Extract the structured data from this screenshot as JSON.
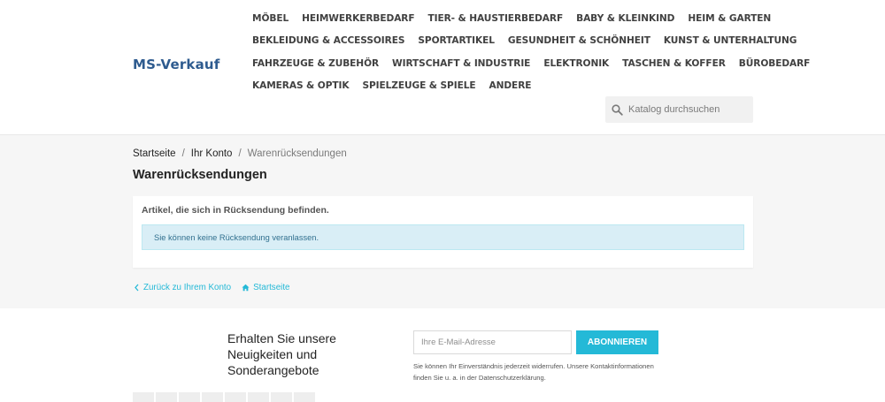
{
  "site": {
    "logo": "MS-Verkauf"
  },
  "nav": {
    "rows": [
      [
        "Möbel",
        "Heimwerkerbedarf",
        "Tier- & Haustierbedarf",
        "Baby & Kleinkind",
        "Heim & Garten"
      ],
      [
        "Bekleidung & Accessoires",
        "Sportartikel",
        "Gesundheit & Schönheit",
        "Kunst & Unterhaltung"
      ],
      [
        "Fahrzeuge & Zubehör",
        "Wirtschaft & Industrie",
        "Elektronik",
        "Taschen & Koffer",
        "Bürobedarf"
      ],
      [
        "Kameras & Optik",
        "Spielzeuge & Spiele",
        "Andere"
      ]
    ]
  },
  "search": {
    "placeholder": "Katalog durchsuchen",
    "icon": "search-icon"
  },
  "breadcrumb": {
    "home": "Startseite",
    "account": "Ihr Konto",
    "current": "Warenrücksendungen"
  },
  "page": {
    "title": "Warenrücksendungen",
    "lead": "Artikel, die sich in Rücksendung befinden.",
    "alert": "Sie können keine Rücksendung veranlassen."
  },
  "links": {
    "back": "Zurück zu Ihrem Konto",
    "home": "Startseite"
  },
  "newsletter": {
    "title": "Erhalten Sie unsere Neuigkeiten und Sonderangebote",
    "placeholder": "Ihre E-Mail-Adresse",
    "button": "Abonnieren",
    "consent": "Sie können Ihr Einverständnis jederzeit widerrufen. Unsere Kontaktinformationen finden Sie u. a. in der Datenschutzerklärung."
  },
  "colors": {
    "accent": "#24b9d7",
    "logo": "#2e5b8f",
    "alert_bg": "#d9eef6",
    "alert_text": "#31708f"
  }
}
